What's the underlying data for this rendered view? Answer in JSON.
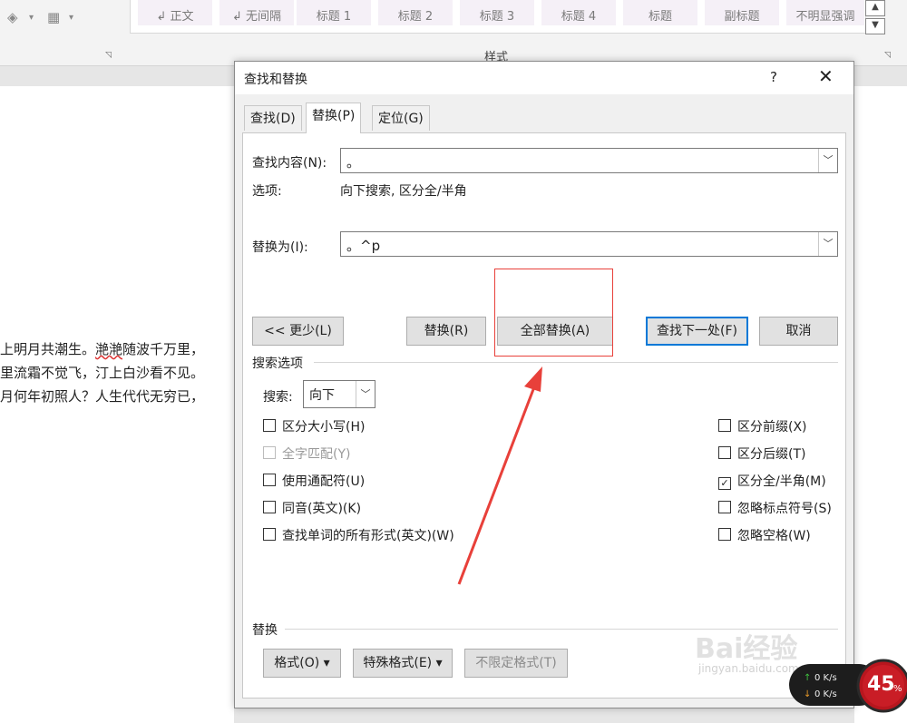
{
  "ribbon": {
    "styles": [
      "↲ 正文",
      "↲ 无间隔",
      "标题 1",
      "标题 2",
      "标题 3",
      "标题 4",
      "标题",
      "副标题",
      "不明显强调"
    ],
    "group_label": "样式"
  },
  "document": {
    "lines": [
      {
        "pre": "上明月共潮生。",
        "squiggle": "滟滟",
        "post": "随波千万里，"
      },
      {
        "pre": "里流霜不觉飞，汀上白沙看不见。",
        "squiggle": "",
        "post": ""
      },
      {
        "pre": "月何年初照人？人生代代无穷已，",
        "squiggle": "",
        "post": ""
      }
    ]
  },
  "dialog": {
    "title": "查找和替换",
    "help": "?",
    "close": "✕",
    "tabs": [
      "查找(D)",
      "替换(P)",
      "定位(G)"
    ],
    "find_label": "查找内容(N):",
    "find_value": "。",
    "options_label": "选项:",
    "options_value": "向下搜索, 区分全/半角",
    "replace_label": "替换为(I):",
    "replace_value": "。^p",
    "buttons": {
      "less": "<< 更少(L)",
      "replace": "替换(R)",
      "replace_all": "全部替换(A)",
      "find_next": "查找下一处(F)",
      "cancel": "取消"
    },
    "search_options_head": "搜索选项",
    "search_label": "搜索:",
    "search_value": "向下",
    "left_checks": [
      {
        "label": "区分大小写(H)",
        "checked": false,
        "disabled": false
      },
      {
        "label": "全字匹配(Y)",
        "checked": false,
        "disabled": true
      },
      {
        "label": "使用通配符(U)",
        "checked": false,
        "disabled": false
      },
      {
        "label": "同音(英文)(K)",
        "checked": false,
        "disabled": false
      },
      {
        "label": "查找单词的所有形式(英文)(W)",
        "checked": false,
        "disabled": false
      }
    ],
    "right_checks": [
      {
        "label": "区分前缀(X)",
        "checked": false
      },
      {
        "label": "区分后缀(T)",
        "checked": false
      },
      {
        "label": "区分全/半角(M)",
        "checked": true
      },
      {
        "label": "忽略标点符号(S)",
        "checked": false
      },
      {
        "label": "忽略空格(W)",
        "checked": false
      }
    ],
    "replace_head": "替换",
    "format_buttons": {
      "format": "格式(O) ▾",
      "special": "特殊格式(E) ▾",
      "no_format": "不限定格式(T)"
    }
  },
  "watermark": {
    "main": "Bai经验",
    "sub": "jingyan.baidu.com"
  },
  "net_meter": {
    "up": "0 K/s",
    "down": "0 K/s",
    "percent": "45",
    "unit": "%"
  },
  "colors": {
    "annotation": "#e8403a",
    "accent": "#0078d7"
  }
}
